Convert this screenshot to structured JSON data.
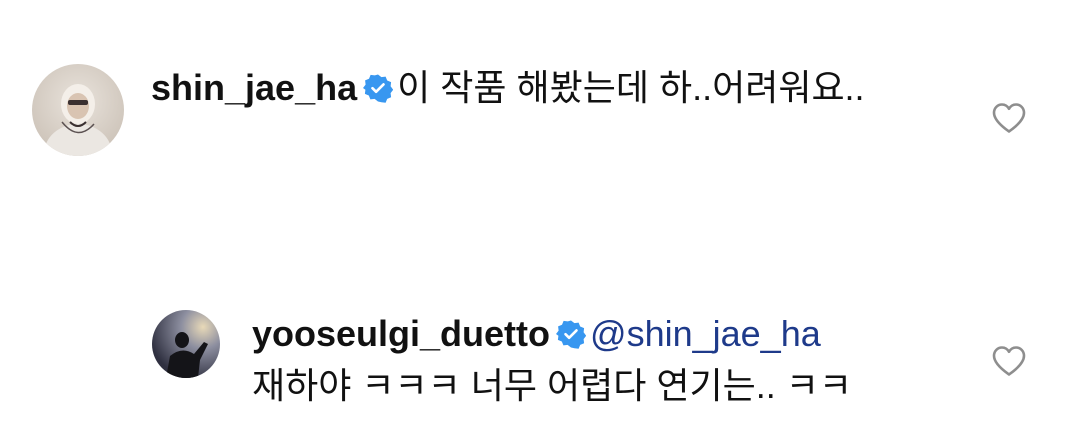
{
  "comments": [
    {
      "username": "shin_jae_ha",
      "verified": true,
      "text": "이 작품 해봤는데 하..어려워요..",
      "avatar_icon": "profile-photo",
      "like_icon": "heart-outline-icon"
    },
    {
      "username": "yooseulgi_duetto",
      "verified": true,
      "mention": "@shin_jae_ha",
      "text": "재하야 ㅋㅋㅋ 너무 어렵다 연기는.. ㅋㅋ",
      "avatar_icon": "profile-photo",
      "like_icon": "heart-outline-icon"
    }
  ],
  "colors": {
    "verified_badge": "#3897f0",
    "mention": "#1e3a8a",
    "text": "#111111",
    "heart_outline": "#8e8e8e"
  }
}
